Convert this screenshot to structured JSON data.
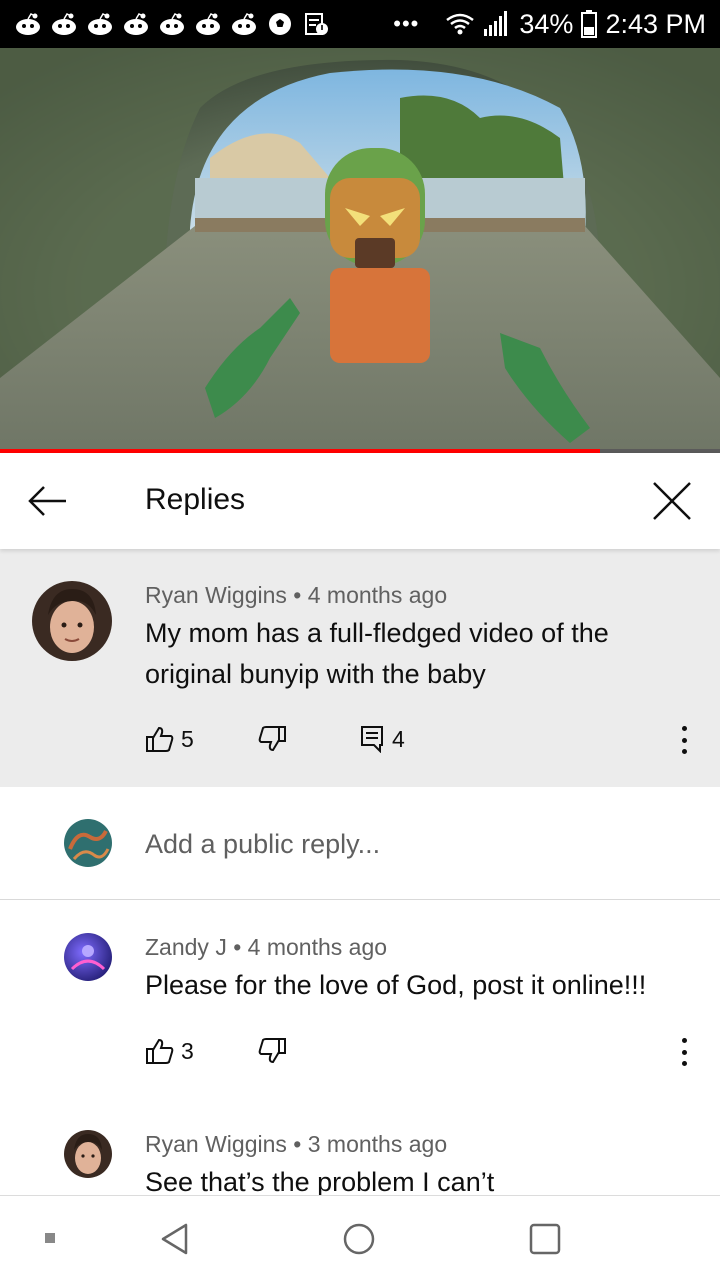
{
  "status_bar": {
    "notification_icons": [
      "reddit-icon",
      "reddit-icon",
      "reddit-icon",
      "reddit-icon",
      "reddit-icon",
      "reddit-icon",
      "reddit-icon",
      "soccer-ball-icon",
      "document-alert-icon"
    ],
    "more_indicator": "•••",
    "battery_percent": "34%",
    "time": "2:43 PM"
  },
  "video": {
    "progress_fraction": 0.833,
    "progress_color": "#ff0000"
  },
  "header": {
    "title": "Replies"
  },
  "parent_comment": {
    "author": "Ryan Wiggins",
    "separator": "•",
    "time": "4 months ago",
    "text_line1": "My mom has a full-fledged video of the",
    "text_line2": "original bunyip with the baby",
    "likes": "5",
    "replies": "4"
  },
  "add_reply": {
    "placeholder": "Add a public reply..."
  },
  "replies": [
    {
      "author": "Zandy J",
      "separator": "•",
      "time": "4 months ago",
      "text": "Please for the love of God, post it online!!!",
      "likes": "3"
    },
    {
      "author": "Ryan Wiggins",
      "separator": "•",
      "time": "3 months ago",
      "text": "See that’s the problem I can’t"
    }
  ],
  "colors": {
    "parent_bg": "#ececec",
    "meta_text": "#606060",
    "accent_red": "#ff0000"
  }
}
